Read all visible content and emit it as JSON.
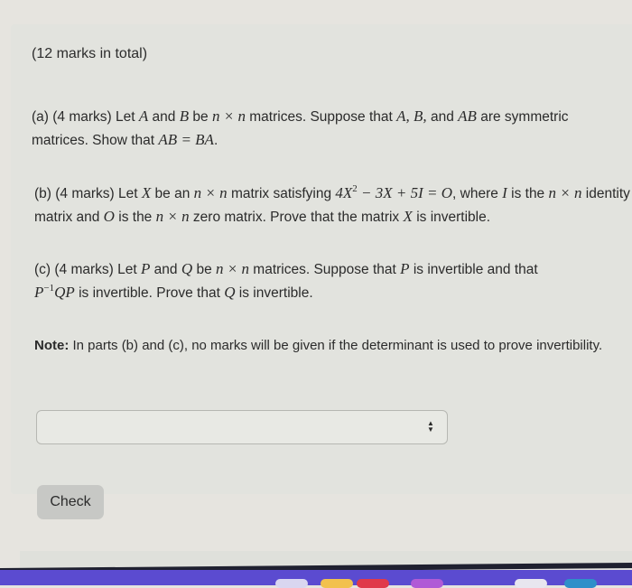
{
  "question": {
    "total_marks": "(12 marks in total)",
    "parts": [
      {
        "id": "a",
        "prefix": "(a) (4 marks)  Let",
        "text_segments": [
          "(a) (4 marks)  Let ",
          "A",
          " and ",
          "B",
          " be ",
          "n × n",
          " matrices. Suppose that ",
          "A, B,",
          " and ",
          "AB",
          " are symmetric matrices.  Show that ",
          "AB = BA",
          "."
        ]
      },
      {
        "id": "b",
        "text_segments": [
          "(b) (4 marks) Let ",
          "X",
          " be an ",
          "n × n",
          " matrix satisfying ",
          "4X",
          "2",
          " − 3X + 5I = O",
          ", where ",
          "I",
          " is the ",
          "n × n",
          " identity matrix and ",
          "O",
          " is the ",
          "n × n",
          " zero matrix. Prove that the matrix ",
          "X",
          " is invertible."
        ]
      },
      {
        "id": "c",
        "text_segments": [
          "(c) (4 marks) Let ",
          "P",
          " and ",
          "Q",
          "  be ",
          "n × n",
          " matrices. Suppose that  ",
          "P",
          " is invertible and that ",
          "P",
          "−1",
          "QP",
          " is invertible.  Prove that ",
          "Q",
          "  is invertible."
        ]
      }
    ],
    "note": {
      "label": "Note:",
      "text": " In parts (b) and (c), no marks will be given if the determinant is used to prove invertibility."
    }
  },
  "answer_select": {
    "selected_value": "",
    "icon": "updown-arrows-icon"
  },
  "check_button": {
    "label": "Check"
  },
  "dock_colors": [
    "#d9d6f0",
    "#f2c14e",
    "#e0394a",
    "#b05ad6",
    "#e8e6ef",
    "#2e8fc9"
  ]
}
